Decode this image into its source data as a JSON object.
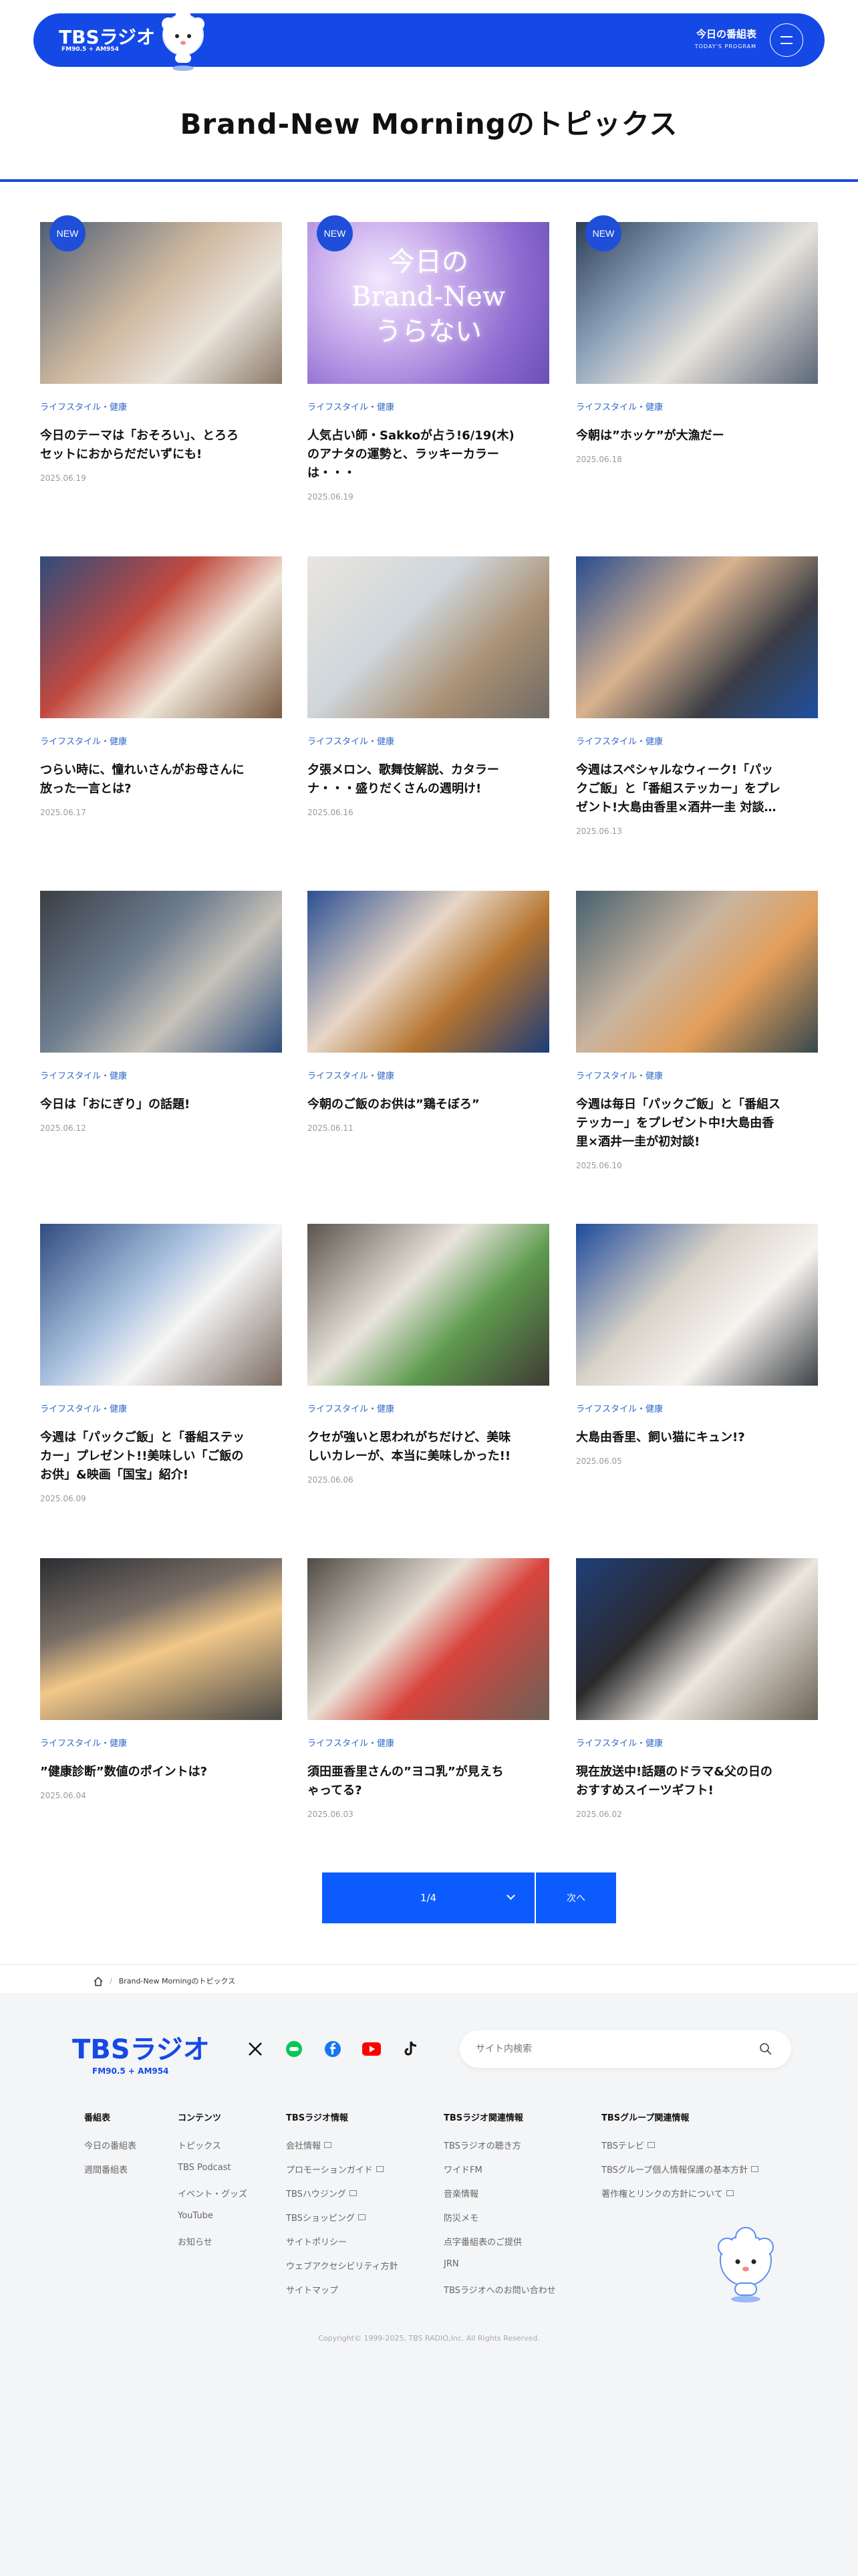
{
  "header": {
    "logo_text": "TBSラジオ",
    "logo_freq": "FM90.5 + AM954",
    "program_label": "今日の番組表",
    "program_sub": "TODAY'S PROGRAM"
  },
  "page_title": "Brand-New Morningのトピックス",
  "articles": [
    {
      "new": "NEW",
      "category": "ライフスタイル・健康",
      "title_lines": [
        "今日のテーマは「おそろい」、とろろ",
        "セットにおからだだいずにも!"
      ],
      "date": "2025.06.19"
    },
    {
      "new": "NEW",
      "image_text_lines": [
        "今日の",
        "Brand-New",
        "うらない"
      ],
      "category": "ライフスタイル・健康",
      "title_lines": [
        "人気占い師・Sakkoが占う!6/19(木)",
        "のアナタの運勢と、ラッキーカラー",
        "は・・・"
      ],
      "date": "2025.06.19"
    },
    {
      "new": "NEW",
      "category": "ライフスタイル・健康",
      "title_lines": [
        "今朝は”ホッケ”が大漁だー"
      ],
      "date": "2025.06.18"
    },
    {
      "category": "ライフスタイル・健康",
      "title_lines": [
        "つらい時に、憧れいさんがお母さんに",
        "放った一言とは?"
      ],
      "date": "2025.06.17"
    },
    {
      "category": "ライフスタイル・健康",
      "title_lines": [
        "夕張メロン、歌舞伎解説、カタラー",
        "ナ・・・盛りだくさんの週明け!"
      ],
      "date": "2025.06.16"
    },
    {
      "category": "ライフスタイル・健康",
      "title_lines": [
        "今週はスペシャルなウィーク!「パッ",
        "クご飯」と「番組ステッカー」をプレ",
        "ゼント!大島由香里×酒井一圭 対談…"
      ],
      "date": "2025.06.13"
    },
    {
      "category": "ライフスタイル・健康",
      "title_lines": [
        "今日は「おにぎり」の話題!"
      ],
      "date": "2025.06.12"
    },
    {
      "category": "ライフスタイル・健康",
      "title_lines": [
        "今朝のご飯のお供は”鶏そぼろ”"
      ],
      "date": "2025.06.11"
    },
    {
      "category": "ライフスタイル・健康",
      "title_lines": [
        "今週は毎日「パックご飯」と「番組ス",
        "テッカー」をプレゼント中!大島由香",
        "里×酒井一圭が初対談!"
      ],
      "date": "2025.06.10"
    },
    {
      "category": "ライフスタイル・健康",
      "title_lines": [
        "今週は「パックご飯」と「番組ステッ",
        "カー」プレゼント!!美味しい「ご飯の",
        "お供」&映画「国宝」紹介!"
      ],
      "date": "2025.06.09"
    },
    {
      "category": "ライフスタイル・健康",
      "title_lines": [
        "クセが強いと思われがちだけど、美味",
        "しいカレーが、本当に美味しかった!!"
      ],
      "date": "2025.06.06"
    },
    {
      "category": "ライフスタイル・健康",
      "title_lines": [
        "大島由香里、飼い猫にキュン!?"
      ],
      "date": "2025.06.05"
    },
    {
      "category": "ライフスタイル・健康",
      "title_lines": [
        "”健康診断”数値のポイントは?"
      ],
      "date": "2025.06.04"
    },
    {
      "category": "ライフスタイル・健康",
      "title_lines": [
        "須田亜香里さんの”ヨコ乳”が見えち",
        "ゃってる?"
      ],
      "date": "2025.06.03"
    },
    {
      "category": "ライフスタイル・健康",
      "title_lines": [
        "現在放送中!話題のドラマ&父の日の",
        "おすすめスイーツギフト!"
      ],
      "date": "2025.06.02"
    }
  ],
  "pagination": {
    "page": "1/4",
    "next": "次へ"
  },
  "breadcrumb": {
    "current": "Brand-New Morningのトピックス"
  },
  "footer": {
    "logo_text": "TBSラジオ",
    "logo_freq": "FM90.5 + AM954",
    "search_placeholder": "サイト内検索",
    "columns": [
      {
        "heading": "番組表",
        "links": [
          "今日の番組表",
          "週間番組表"
        ]
      },
      {
        "heading": "コンテンツ",
        "links": [
          "トピックス",
          "TBS Podcast",
          "イベント・グッズ",
          "YouTube",
          "お知らせ"
        ]
      },
      {
        "heading": "TBSラジオ情報",
        "links": [
          "会社情報",
          "プロモーションガイド",
          "TBSハウジング",
          "TBSショッピング",
          "サイトポリシー",
          "ウェブアクセシビリティ方針",
          "サイトマップ"
        ]
      },
      {
        "heading": "TBSラジオ関連情報",
        "links": [
          "TBSラジオの聴き方",
          "ワイドFM",
          "音楽情報",
          "防災メモ",
          "点字番組表のご提供",
          "JRN",
          "TBSラジオへのお問い合わせ"
        ]
      },
      {
        "heading": "TBSグループ関連情報",
        "links": [
          "TBSテレビ",
          "TBSグループ個人情報保護の基本方針",
          "著作権とリンクの方針について"
        ]
      }
    ],
    "copyright": "Copyright© 1999-2025, TBS RADIO,Inc. All Rights Reserved."
  },
  "colors": {
    "brand_blue": "#1f4fd8",
    "pagination_blue": "#0b5bff",
    "category_blue": "#2f67c8"
  }
}
